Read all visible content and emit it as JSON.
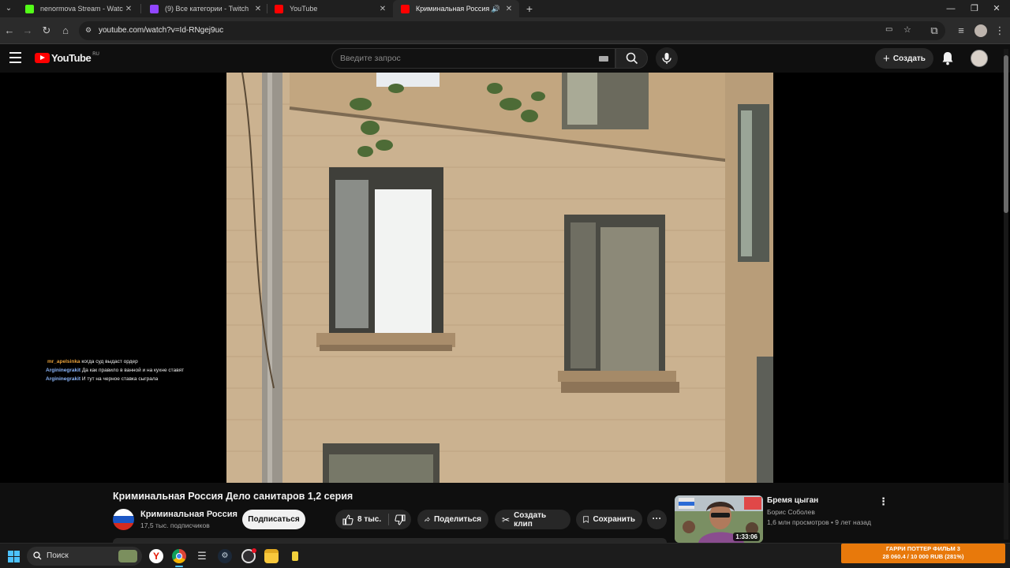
{
  "browser": {
    "tabs": [
      {
        "title": "nenormova Stream - Watch Liv",
        "favicon_color": "#53fc18"
      },
      {
        "title": "(9) Все категории - Twitch",
        "favicon_color": "#9146ff"
      },
      {
        "title": "YouTube",
        "favicon_color": "#ff0000"
      },
      {
        "title": "Криминальная Россия Дело",
        "favicon_color": "#ff0000"
      }
    ],
    "url": "youtube.com/watch?v=Id-RNgej9uc"
  },
  "youtube": {
    "logo_text": "YouTube",
    "logo_region": "RU",
    "search_placeholder": "Введите запрос",
    "create_label": "Создать"
  },
  "chat": [
    {
      "user": "mr_apelsinka",
      "message": "когда суд выдаст ордер"
    },
    {
      "user": "Argininegrakit",
      "message": "Да как правило в ванной и на кухне ставят"
    },
    {
      "user": "Argininegrakit",
      "message": "И тут на черное ставка сыграла"
    }
  ],
  "video": {
    "title": "Криминальная Россия Дело санитаров 1,2 серия",
    "channel_name": "Криминальная Россия",
    "subscribers": "17,5 тыс. подписчиков",
    "subscribe_label": "Подписаться",
    "likes": "8 тыс.",
    "share_label": "Поделиться",
    "clip_label": "Создать клип",
    "save_label": "Сохранить"
  },
  "recommendation": {
    "title": "Бремя цыган",
    "channel": "Борис Соболев",
    "meta": "1,6 млн просмотров • 9 лет назад",
    "duration": "1:33:06"
  },
  "taskbar": {
    "search_label": "Поиск"
  },
  "donation": {
    "title": "ГАРРИ ПОТТЕР ФИЛЬМ 3",
    "progress_text": "28 060.4 / 10 000 RUB (281%)"
  },
  "colors": {
    "youtube_red": "#ff0000",
    "donation_orange": "#e8790b",
    "chat_user_orange": "#e8a13a",
    "chat_user_blue": "#8ab4f8"
  }
}
